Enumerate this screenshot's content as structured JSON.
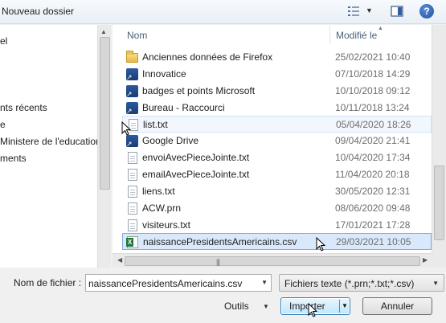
{
  "toolbar": {
    "new_folder_label": "Nouveau dossier",
    "view_icon": "view-list-icon",
    "pane_icon": "preview-pane-icon",
    "help_label": "?"
  },
  "nav": {
    "items": [
      {
        "label": "el"
      },
      {
        "label": "nts récents"
      },
      {
        "label": "e"
      },
      {
        "label": "Ministere de l'education"
      },
      {
        "label": "ments"
      }
    ]
  },
  "list": {
    "columns": {
      "name": "Nom",
      "modified": "Modifié le"
    },
    "rows": [
      {
        "name": "Anciennes données de Firefox",
        "date": "25/02/2021 10:40",
        "icon": "folder"
      },
      {
        "name": "Innovatice",
        "date": "07/10/2018 14:29",
        "icon": "shortcut"
      },
      {
        "name": "badges et points Microsoft",
        "date": "10/10/2018 09:12",
        "icon": "shortcut"
      },
      {
        "name": "Bureau - Raccourci",
        "date": "10/11/2018 13:24",
        "icon": "shortcut"
      },
      {
        "name": "list.txt",
        "date": "05/04/2020 18:26",
        "icon": "doc"
      },
      {
        "name": "Google Drive",
        "date": "09/04/2020 21:41",
        "icon": "shortcut"
      },
      {
        "name": "envoiAvecPieceJointe.txt",
        "date": "10/04/2020 17:34",
        "icon": "doc"
      },
      {
        "name": "emailAvecPieceJointe.txt",
        "date": "11/04/2020 20:18",
        "icon": "doc"
      },
      {
        "name": "liens.txt",
        "date": "30/05/2020 12:31",
        "icon": "doc"
      },
      {
        "name": "ACW.prn",
        "date": "08/06/2020 09:48",
        "icon": "doc"
      },
      {
        "name": "visiteurs.txt",
        "date": "17/01/2021 17:28",
        "icon": "doc"
      },
      {
        "name": "naissancePresidentsAmericains.csv",
        "date": "29/03/2021 10:05",
        "icon": "excel"
      }
    ]
  },
  "footer": {
    "filename_label": "Nom de fichier :",
    "filename_value": "naissancePresidentsAmericains.csv",
    "filetype_value": "Fichiers texte (*.prn;*.txt;*.csv)",
    "tools_label": "Outils",
    "import_label": "Importer",
    "cancel_label": "Annuler"
  },
  "colors": {
    "selected_row": "#d9e9fb",
    "hover_row": "#f2f7fd",
    "accent": "#3c7fb1"
  }
}
